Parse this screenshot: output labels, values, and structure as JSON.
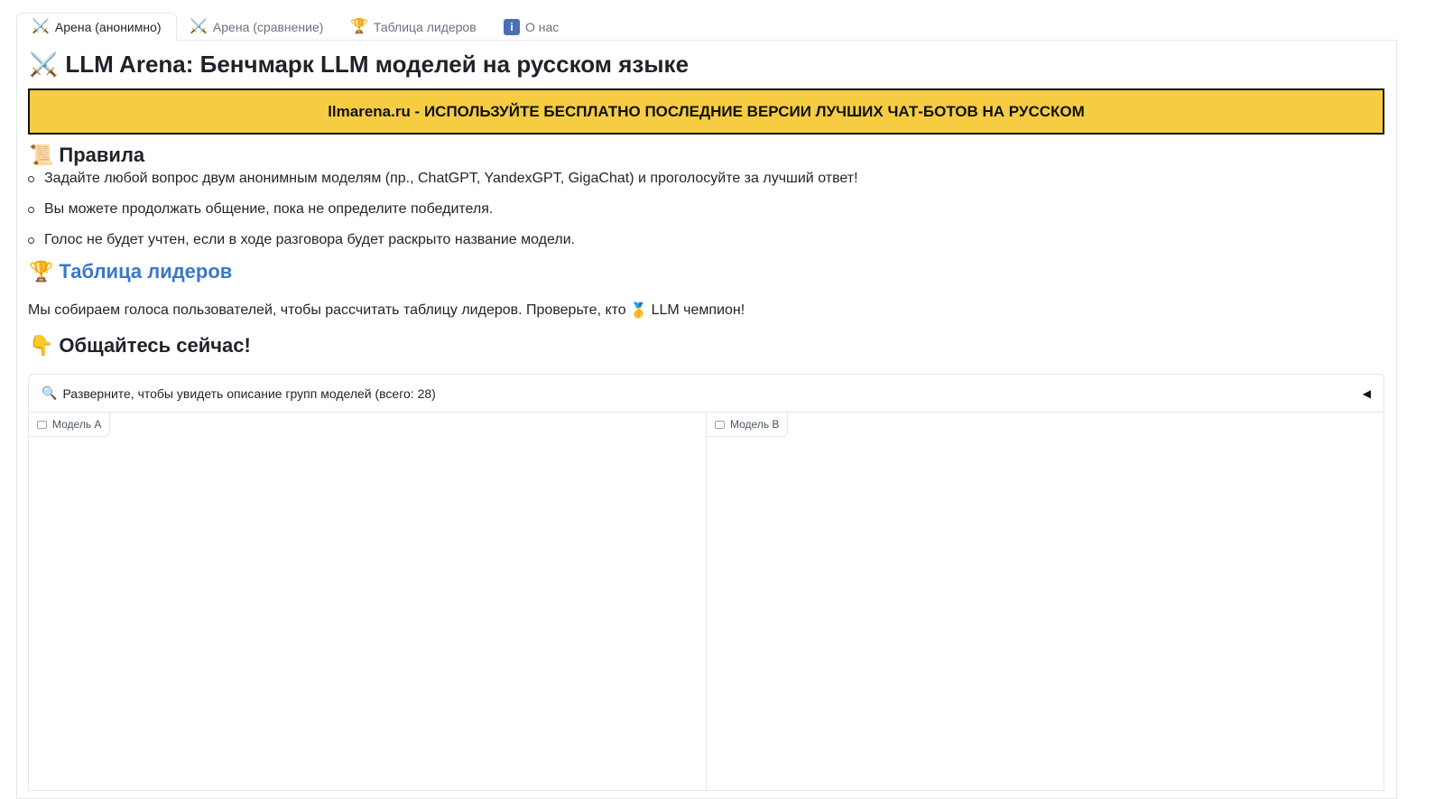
{
  "tabs": [
    {
      "icon": "⚔️",
      "label": "Арена (анонимно)",
      "active": true
    },
    {
      "icon": "⚔️",
      "label": "Арена (сравнение)",
      "active": false
    },
    {
      "icon": "🏆",
      "label": "Таблица лидеров",
      "active": false
    },
    {
      "icon": "i",
      "label": "О нас",
      "active": false
    }
  ],
  "title": {
    "icon": "⚔️",
    "text": "LLM Arena: Бенчмарк LLM моделей на русском языке"
  },
  "banner": {
    "text": "llmarena.ru - ИСПОЛЬЗУЙТЕ БЕСПЛАТНО ПОСЛЕДНИЕ ВЕРСИИ ЛУЧШИХ ЧАТ-БОТОВ НА РУССКОМ",
    "color": "#f6cd42"
  },
  "rules": {
    "icon": "📜",
    "heading": "Правила",
    "items": [
      "Задайте любой вопрос двум анонимным моделям (пр., ChatGPT, YandexGPT, GigaChat) и проголосуйте за лучший ответ!",
      "Вы можете продолжать общение, пока не определите победителя.",
      "Голос не будет учтен, если в ходе разговора будет раскрыто название модели."
    ]
  },
  "leaderboard": {
    "icon": "🏆",
    "heading": "Таблица лидеров",
    "link_color": "#3a78c8",
    "text_before": "Мы собираем голоса пользователей, чтобы рассчитать таблицу лидеров. Проверьте, кто",
    "medal": "🥇",
    "text_after": "LLM чемпион!"
  },
  "chat_now": {
    "icon": "👇",
    "heading": "Общайтесь сейчас!"
  },
  "accordion": {
    "icon": "🔍",
    "label": "Разверните, чтобы увидеть описание групп моделей (всего: 28)",
    "arrow": "◀"
  },
  "chat_a": {
    "label": "Модель A"
  },
  "chat_b": {
    "label": "Модель B"
  }
}
